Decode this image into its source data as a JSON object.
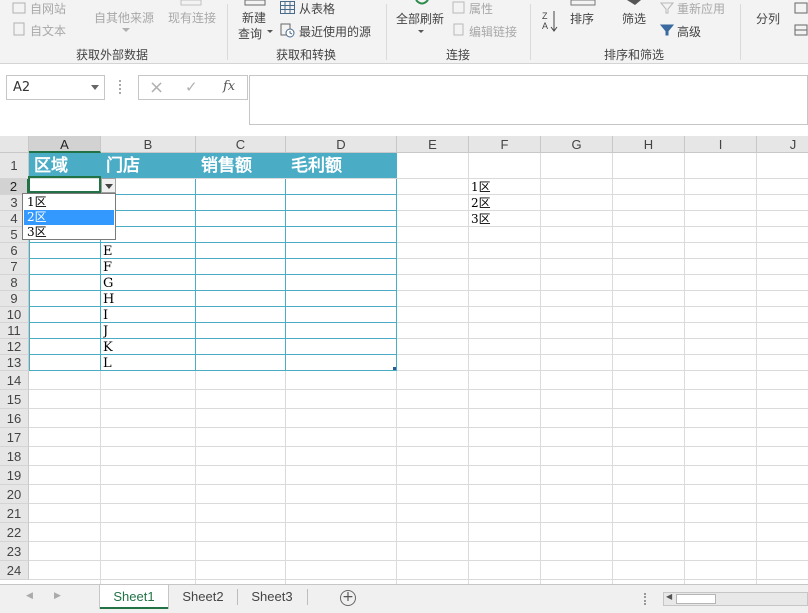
{
  "ribbon": {
    "ext_data": {
      "from_web": "自网站",
      "from_text": "自文本",
      "from_other": "自其他来源",
      "existing": "现有连接",
      "group": "获取外部数据"
    },
    "transform": {
      "new_query_line1": "新建",
      "new_query_line2": "查询",
      "from_table": "从表格",
      "recent_sources": "最近使用的源",
      "group": "获取和转换"
    },
    "connections": {
      "refresh_all": "全部刷新",
      "properties": "属性",
      "edit_links": "编辑链接",
      "group": "连接"
    },
    "sort_filter": {
      "sort": "排序",
      "filter": "筛选",
      "reapply": "重新应用",
      "advanced": "高级",
      "group": "排序和筛选"
    },
    "data_tools": {
      "split": "分列"
    }
  },
  "formula_bar": {
    "name_box": "A2",
    "cancel_icon": "×",
    "enter_icon": "✓",
    "fx_label": "fx",
    "formula": ""
  },
  "grid": {
    "columns": [
      "A",
      "B",
      "C",
      "D",
      "E",
      "F",
      "G",
      "H",
      "I",
      "J"
    ],
    "rows": [
      "1",
      "2",
      "3",
      "4",
      "5",
      "6",
      "7",
      "8",
      "9",
      "10",
      "11",
      "12",
      "13",
      "14",
      "15",
      "16",
      "17",
      "18",
      "19",
      "20",
      "21",
      "22",
      "23",
      "24"
    ],
    "header_row": [
      "区域",
      "门店",
      "销售额",
      "毛利额"
    ],
    "col_b_values": [
      "E",
      "F",
      "G",
      "H",
      "I",
      "J",
      "K",
      "L"
    ],
    "col_f_values": [
      "1区",
      "2区",
      "3区"
    ]
  },
  "dropdown": {
    "options": [
      "1区",
      "2区",
      "3区"
    ],
    "highlighted": "2区"
  },
  "sheets": {
    "tabs": [
      "Sheet1",
      "Sheet2",
      "Sheet3"
    ],
    "active": "Sheet1",
    "add_icon": "+"
  },
  "colors": {
    "table_header": "#4bacc6",
    "accent": "#217346",
    "dropdown_highlight": "#3399ff"
  }
}
